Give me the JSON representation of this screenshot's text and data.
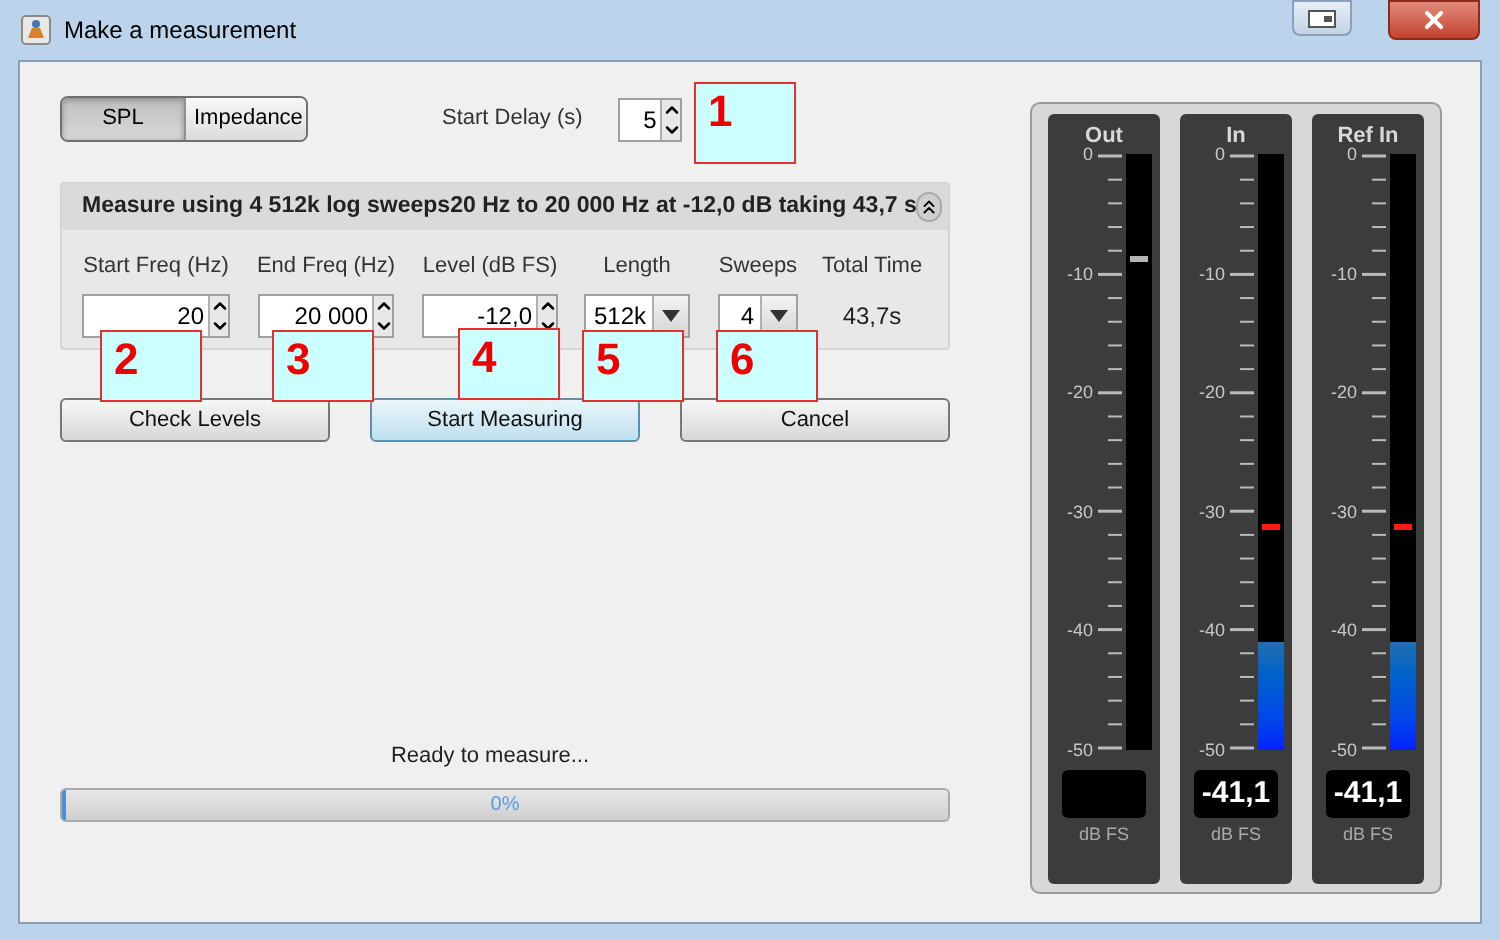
{
  "window": {
    "title": "Make a measurement"
  },
  "mode_tabs": [
    {
      "label": "SPL",
      "selected": true
    },
    {
      "label": "Impedance",
      "selected": false
    }
  ],
  "start_delay": {
    "label": "Start Delay (s)",
    "value": "5"
  },
  "sweep_panel": {
    "summary": "Measure using 4  512k log sweeps20 Hz to 20 000 Hz at -12,0 dB taking 43,7 s",
    "expanded": true,
    "fields": [
      {
        "label": "Start Freq (Hz)",
        "value": "20",
        "kind": "spinner"
      },
      {
        "label": "End Freq (Hz)",
        "value": "20 000",
        "kind": "spinner"
      },
      {
        "label": "Level (dB FS)",
        "value": "-12,0",
        "kind": "spinner"
      },
      {
        "label": "Length",
        "value": "512k",
        "kind": "dropdown"
      },
      {
        "label": "Sweeps",
        "value": "4",
        "kind": "dropdown"
      },
      {
        "label": "Total Time",
        "value": "43,7s",
        "kind": "readout"
      }
    ]
  },
  "buttons": [
    {
      "label": "Check Levels",
      "focused": false
    },
    {
      "label": "Start Measuring",
      "focused": true
    },
    {
      "label": "Cancel",
      "focused": false
    }
  ],
  "status": "Ready to measure...",
  "progress": {
    "level": 0,
    "label": "0%"
  },
  "meters": [
    {
      "title": "Out",
      "scale": [
        "0",
        "-10",
        "-20",
        "-30",
        "-40",
        "-50"
      ],
      "peak": {
        "level": 0.82,
        "color": "#b4b4b4"
      },
      "unit": "dB FS"
    },
    {
      "title": "In",
      "scale": [
        "0",
        "-10",
        "-20",
        "-30",
        "-40",
        "-50"
      ],
      "level": 0.18,
      "peak": {
        "level": 0.37,
        "color": "#ff1a1a"
      },
      "reading": "-41,1",
      "unit": "dB FS"
    },
    {
      "title": "Ref In",
      "scale": [
        "0",
        "-10",
        "-20",
        "-30",
        "-40",
        "-50"
      ],
      "level": 0.18,
      "peak": {
        "level": 0.37,
        "color": "#ff1a1a"
      },
      "reading": "-41,1",
      "unit": "dB FS"
    }
  ],
  "callouts": [
    "1",
    "2",
    "3",
    "4",
    "5",
    "6"
  ]
}
